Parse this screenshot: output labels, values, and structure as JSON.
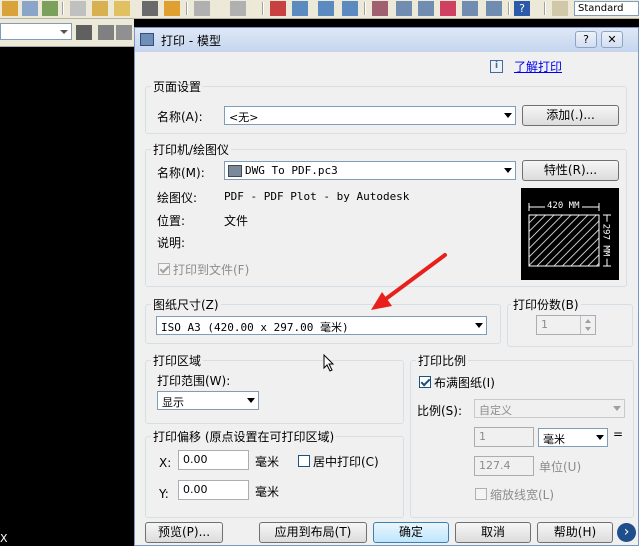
{
  "toolbar": {
    "standard_label": "Standard"
  },
  "dialog": {
    "title": "打印 - 模型",
    "help_question": "?",
    "close_label": "✕",
    "info_link": "了解打印",
    "page_setup": {
      "group_label": "页面设置",
      "name_label": "名称(A):",
      "name_value": "<无>",
      "add_button": "添加(.)..."
    },
    "printer": {
      "group_label": "打印机/绘图仪",
      "name_label": "名称(M):",
      "name_value": "DWG To PDF.pc3",
      "properties_button": "特性(R)...",
      "plotter_label": "绘图仪:",
      "plotter_value": "PDF - PDF Plot - by Autodesk",
      "location_label": "位置:",
      "location_value": "文件",
      "description_label": "说明:",
      "print_to_file_label": "打印到文件(F)",
      "preview_width": "420 MM",
      "preview_height": "297 MM"
    },
    "paper_size": {
      "group_label": "图纸尺寸(Z)",
      "value": "ISO A3 (420.00 x 297.00 毫米)"
    },
    "copies": {
      "group_label": "打印份数(B)",
      "value": "1"
    },
    "plot_area": {
      "group_label": "打印区域",
      "range_label": "打印范围(W):",
      "range_value": "显示"
    },
    "plot_offset": {
      "group_label": "打印偏移 (原点设置在可打印区域)",
      "x_label": "X:",
      "x_value": "0.00",
      "x_unit": "毫米",
      "y_label": "Y:",
      "y_value": "0.00",
      "y_unit": "毫米",
      "center_label": "居中打印(C)"
    },
    "plot_scale": {
      "group_label": "打印比例",
      "fit_label": "布满图纸(I)",
      "scale_label": "比例(S):",
      "scale_value": "自定义",
      "value1": "1",
      "unit_value": "毫米",
      "equals": "=",
      "value2": "127.4",
      "unit_label": "单位(U)",
      "lineweight_label": "缩放线宽(L)"
    },
    "buttons": {
      "preview": "预览(P)...",
      "apply": "应用到布局(T)",
      "ok": "确定",
      "cancel": "取消",
      "help": "帮助(H)",
      "more": "›"
    }
  },
  "colors": {
    "arrow": "#e8201c",
    "accent": "#3c7fb1"
  }
}
